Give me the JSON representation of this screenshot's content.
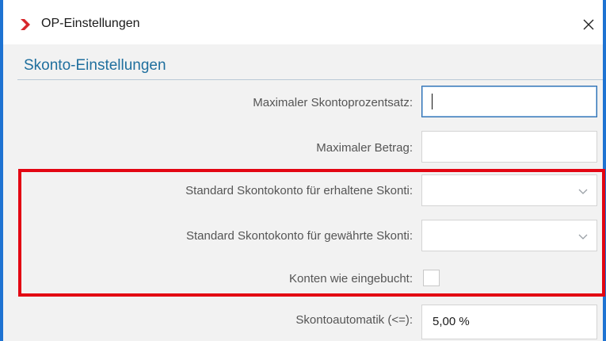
{
  "window": {
    "title": "OP-Einstellungen",
    "app_icon": "chevron-right-logo-icon",
    "close_icon": "close-icon",
    "accent_color": "#1e73d2"
  },
  "section": {
    "title": "Skonto-Einstellungen",
    "title_color": "#1f6f9e"
  },
  "fields": {
    "max_percent": {
      "label": "Maximaler Skontoprozentsatz:",
      "value": ""
    },
    "max_amount": {
      "label": "Maximaler Betrag:",
      "value": ""
    },
    "received_account": {
      "label": "Standard Skontokonto für erhaltene Skonti:",
      "value": "",
      "icon": "chevron-down-icon"
    },
    "granted_account": {
      "label": "Standard Skontokonto für gewährte Skonti:",
      "value": "",
      "icon": "chevron-down-icon"
    },
    "as_booked": {
      "label": "Konten wie eingebucht:",
      "checked": false
    },
    "automatic": {
      "label": "Skontoautomatik (<=):",
      "value": "5,00 %"
    }
  },
  "highlight": {
    "color": "#e30613"
  }
}
